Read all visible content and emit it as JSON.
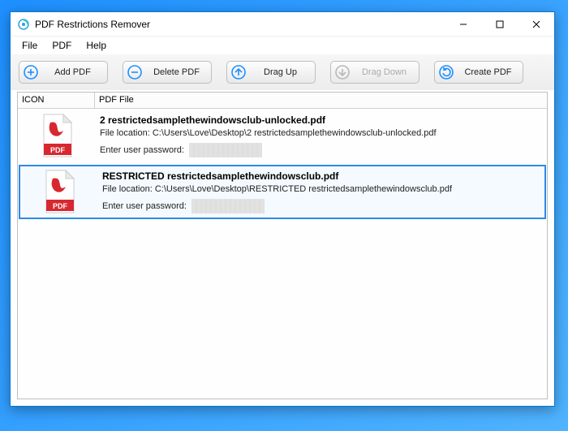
{
  "title": "PDF Restrictions Remover",
  "menu": {
    "file": "File",
    "pdf": "PDF",
    "help": "Help"
  },
  "toolbar": {
    "add": "Add PDF",
    "delete": "Delete PDF",
    "dragUp": "Drag Up",
    "dragDown": "Drag Down",
    "create": "Create PDF"
  },
  "columns": {
    "icon": "ICON",
    "file": "PDF File"
  },
  "locLabel": "File location: ",
  "pwLabel": "Enter user password:",
  "files": [
    {
      "name": "2 restrictedsamplethewindowsclub-unlocked.pdf",
      "location": "C:\\Users\\Love\\Desktop\\2 restrictedsamplethewindowsclub-unlocked.pdf"
    },
    {
      "name": "RESTRICTED restrictedsamplethewindowsclub.pdf",
      "location": "C:\\Users\\Love\\Desktop\\RESTRICTED restrictedsamplethewindowsclub.pdf"
    }
  ]
}
